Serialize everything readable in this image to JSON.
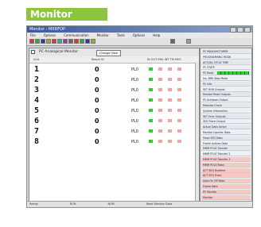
{
  "badge": {
    "label": "Monitor"
  },
  "window": {
    "title": "Monitor - MXRFOP"
  },
  "menu": [
    "File",
    "Options",
    "Communication",
    "Monitor",
    "Tools",
    "Options",
    "Help"
  ],
  "panel": {
    "title": "PC Analogical Monitor",
    "button": "Change View",
    "col_a": "Unit",
    "col_b": "Result ID",
    "col_c": "IN OUT ENA INT TM MHC"
  },
  "rows": [
    {
      "n": "1",
      "v": "0",
      "p": "PL0"
    },
    {
      "n": "2",
      "v": "0",
      "p": "PL0"
    },
    {
      "n": "3",
      "v": "0",
      "p": "PL0"
    },
    {
      "n": "4",
      "v": "0",
      "p": "PL0"
    },
    {
      "n": "5",
      "v": "0",
      "p": "PL0"
    },
    {
      "n": "6",
      "v": "0",
      "p": "PL0"
    },
    {
      "n": "7",
      "v": "0",
      "p": "PL0"
    },
    {
      "n": "8",
      "v": "0",
      "p": "PL0"
    }
  ],
  "side": [
    "PC MANUFACTURER",
    "PROGRAMMING MODE",
    "ACTUAL CYCLE TIME",
    "PC STATE",
    "PC Read",
    "Ins. BRK Step Mode",
    "PC Info",
    "SET RUN Outputs",
    "Monitor Read Outputs",
    "PC Ackdown Output",
    "Modules Check",
    "System Information",
    "SET Error Outputs",
    "SEQ Trace Output",
    "Actual Data Active",
    "Monitor Counter Data",
    "Trace SEQ Data",
    "Frame Actives Data",
    "MMM POLE Transfer",
    "MMM POLE Transfer 2",
    "MMM POLE Transfer 3",
    "MMM POLE Read",
    "ACT SEQ Runtime",
    "ACT SEQ Trace",
    "Auto On Off Data",
    "Frame Data",
    "PC Monitor",
    "Monitor"
  ],
  "status": [
    "Ready",
    "RUN",
    "NUM",
    "Read Monitor Data"
  ],
  "colors": {
    "badge": "#8cc63e",
    "led_green": "#33cc33",
    "led_pink": "#f4a3a3",
    "side_pink": "#f7c9c4"
  }
}
